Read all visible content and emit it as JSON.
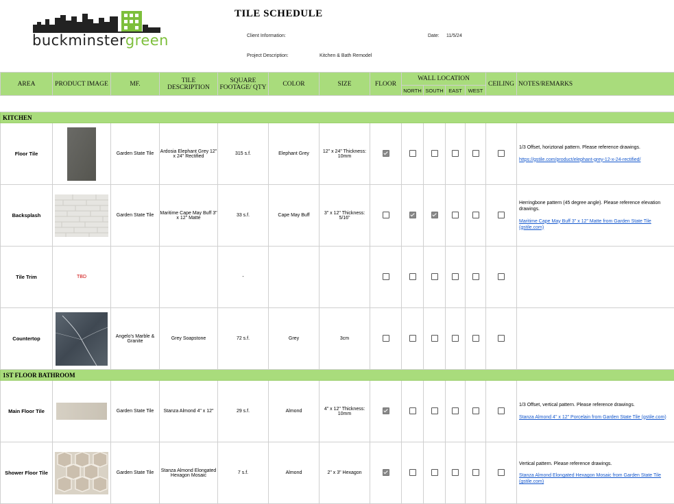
{
  "header": {
    "logo_text_dark": "buckminster",
    "logo_text_green": "green",
    "title": "TILE SCHEDULE",
    "client_label": "Client Information:",
    "date_label": "Date:",
    "date_value": "11/5/24",
    "project_label": "Project Description:",
    "project_value": "Kitchen & Bath Remodel"
  },
  "columns": {
    "area": "AREA",
    "image": "PRODUCT IMAGE",
    "mf": "MF.",
    "desc": "TILE DESCRIPTION",
    "sqft": "SQUARE FOOTAGE/ QTY",
    "color": "COLOR",
    "size": "SIZE",
    "floor": "FLOOR",
    "wall": "WALL LOCATION",
    "north": "NORTH",
    "south": "SOUTH",
    "east": "EAST",
    "west": "WEST",
    "ceiling": "CEILING",
    "notes": "NOTES/REMARKS"
  },
  "sections": [
    {
      "name": "KITCHEN",
      "rows": [
        {
          "area": "Floor Tile",
          "image": "dark-grey-tile",
          "mf": "Garden State Tile",
          "desc": "Ardosia Elephant Grey 12\" x 24\" Rectified",
          "sqft": "315 s.f.",
          "color": "Elephant Grey",
          "size": "12\" x 24\" Thickness: 10mm",
          "checks": [
            true,
            false,
            false,
            false,
            false,
            false
          ],
          "note": "1/3 Offset, horiztonal pattern. Please reference drawings.",
          "link": "https://gstile.com/product/elephant-grey-12-x-24-rectified/"
        },
        {
          "area": "Backsplash",
          "image": "white-subway-tile",
          "mf": "Garden State Tile",
          "desc": "Maritime Cape May Buff 3\" x 12\" Matte",
          "sqft": "33 s.f.",
          "color": "Cape May Buff",
          "size": "3\" x 12\" Thickness: 5/16\"",
          "checks": [
            false,
            true,
            true,
            false,
            false,
            false
          ],
          "note": "Herringbone pattern (45 degree angle). Please reference elevation drawings.",
          "link": "Maritime Cape May Buff 3\" x 12\" Matte from Garden State Tile (gstile.com)"
        },
        {
          "area": "Tile Trim",
          "image_text": "TBD",
          "mf": "",
          "desc": "",
          "sqft": "-",
          "color": "",
          "size": "",
          "checks": [
            false,
            false,
            false,
            false,
            false,
            false
          ],
          "note": "",
          "link": ""
        },
        {
          "area": "Countertop",
          "image": "soapstone-slab",
          "mf": "Angelo's Marble & Granite",
          "desc": "Grey Soapstone",
          "sqft": "72 s.f.",
          "color": "Grey",
          "size": "3cm",
          "checks": [
            false,
            false,
            false,
            false,
            false,
            false
          ],
          "note": "",
          "link": ""
        }
      ]
    },
    {
      "name": "1ST FLOOR BATHROOM",
      "rows": [
        {
          "area": "Main Floor Tile",
          "image": "almond-tile",
          "mf": "Garden State Tile",
          "desc": "Stanza Almond 4\" x 12\"",
          "sqft": "29 s.f.",
          "color": "Almond",
          "size": "4\" x 12\" Thickness: 10mm",
          "checks": [
            true,
            false,
            false,
            false,
            false,
            false
          ],
          "note": "1/3 Offset, vertical pattern. Please reference drawings.",
          "link": "Stanza Almond 4\" x 12\" Porcelain from Garden State Tile (gstile.com)"
        },
        {
          "area": "Shower Floor Tile",
          "image": "hexagon-mosaic",
          "mf": "Garden State Tile",
          "desc": "Stanza Almond Elongated Hexagon Mosaic",
          "sqft": "7 s.f.",
          "color": "Almond",
          "size": "2\" x 3\" Hexagon",
          "checks": [
            true,
            false,
            false,
            false,
            false,
            false
          ],
          "note": "Vertical pattern. Please reference drawings.",
          "link": "Stanza Almond Elongated Hexagon Mosaic from Garden State Tile (gstile.com)"
        }
      ]
    }
  ],
  "colors": {
    "header_green": "#a9dc7c",
    "logo_green": "#7dbf3c",
    "link": "#1155cc",
    "tbd": "#cc0000"
  }
}
